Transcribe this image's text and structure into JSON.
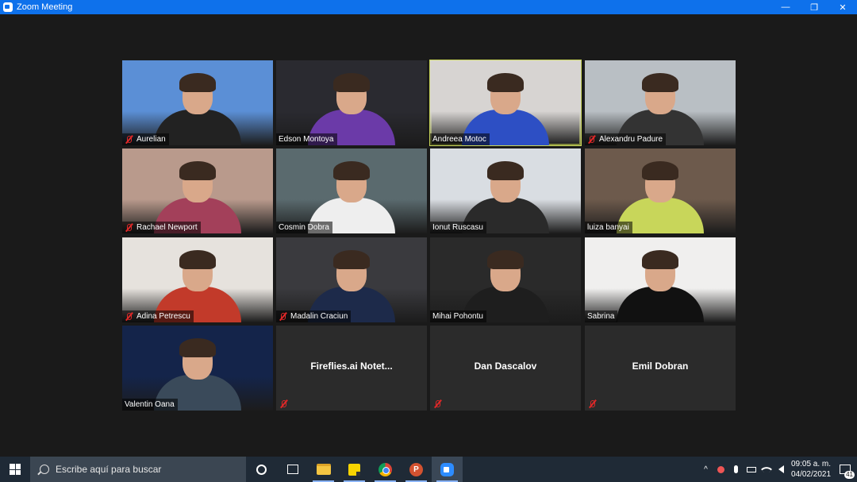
{
  "window": {
    "title": "Zoom Meeting",
    "minimize": "—",
    "restore": "❐",
    "close": "✕"
  },
  "participants": [
    {
      "name": "Aurelian",
      "muted": true,
      "video": true,
      "bg": "#5b8fd6",
      "shirt": "#222"
    },
    {
      "name": "Edson Montoya",
      "muted": false,
      "video": true,
      "bg": "#2a2a30",
      "shirt": "#6b3aa8"
    },
    {
      "name": "Andreea Motoc",
      "muted": false,
      "video": true,
      "active": true,
      "bg": "#d7d4d2",
      "shirt": "#2d4fc4"
    },
    {
      "name": "Alexandru Padure",
      "muted": true,
      "video": true,
      "bg": "#b9bfc4",
      "shirt": "#333"
    },
    {
      "name": "Rachael Newport",
      "muted": true,
      "video": true,
      "bg": "#b99a8c",
      "shirt": "#a3405a"
    },
    {
      "name": "Cosmin Dobra",
      "muted": false,
      "video": true,
      "bg": "#5a6a6e",
      "shirt": "#eeeeee"
    },
    {
      "name": "Ionut Ruscasu",
      "muted": false,
      "video": true,
      "bg": "#d9dde2",
      "shirt": "#2a2a2a"
    },
    {
      "name": "luiza banyai",
      "muted": false,
      "video": true,
      "bg": "#6d5a4c",
      "shirt": "#c8d65a"
    },
    {
      "name": "Adina Petrescu",
      "muted": true,
      "video": true,
      "bg": "#e6e2dd",
      "shirt": "#c23a2a"
    },
    {
      "name": "Madalin Craciun",
      "muted": true,
      "video": true,
      "bg": "#3a3a3e",
      "shirt": "#1d2a4a"
    },
    {
      "name": "Mihai Pohontu",
      "muted": false,
      "video": true,
      "bg": "#2a2a2a",
      "shirt": "#1e1e1e"
    },
    {
      "name": "Sabrina",
      "muted": false,
      "video": true,
      "bg": "#f0efee",
      "shirt": "#111"
    },
    {
      "name": "Valentin Oana",
      "muted": false,
      "video": true,
      "bg": "#14244a",
      "shirt": "#3a4a5a"
    },
    {
      "name": "Fireflies.ai  Notet...",
      "muted": true,
      "video": false
    },
    {
      "name": "Dan Dascalov",
      "muted": true,
      "video": false
    },
    {
      "name": "Emil Dobran",
      "muted": true,
      "video": false
    }
  ],
  "taskbar": {
    "search_placeholder": "Escribe aquí para buscar",
    "apps": [
      "cortana-icon",
      "task-view-icon",
      "file-explorer-icon",
      "sticky-notes-icon",
      "chrome-icon",
      "powerpoint-icon",
      "zoom-icon"
    ],
    "ppt_letter": "P",
    "tray": {
      "chevron": "^",
      "language": "",
      "time": "09:05 a. m.",
      "date": "04/02/2021",
      "notification_count": "41"
    }
  }
}
